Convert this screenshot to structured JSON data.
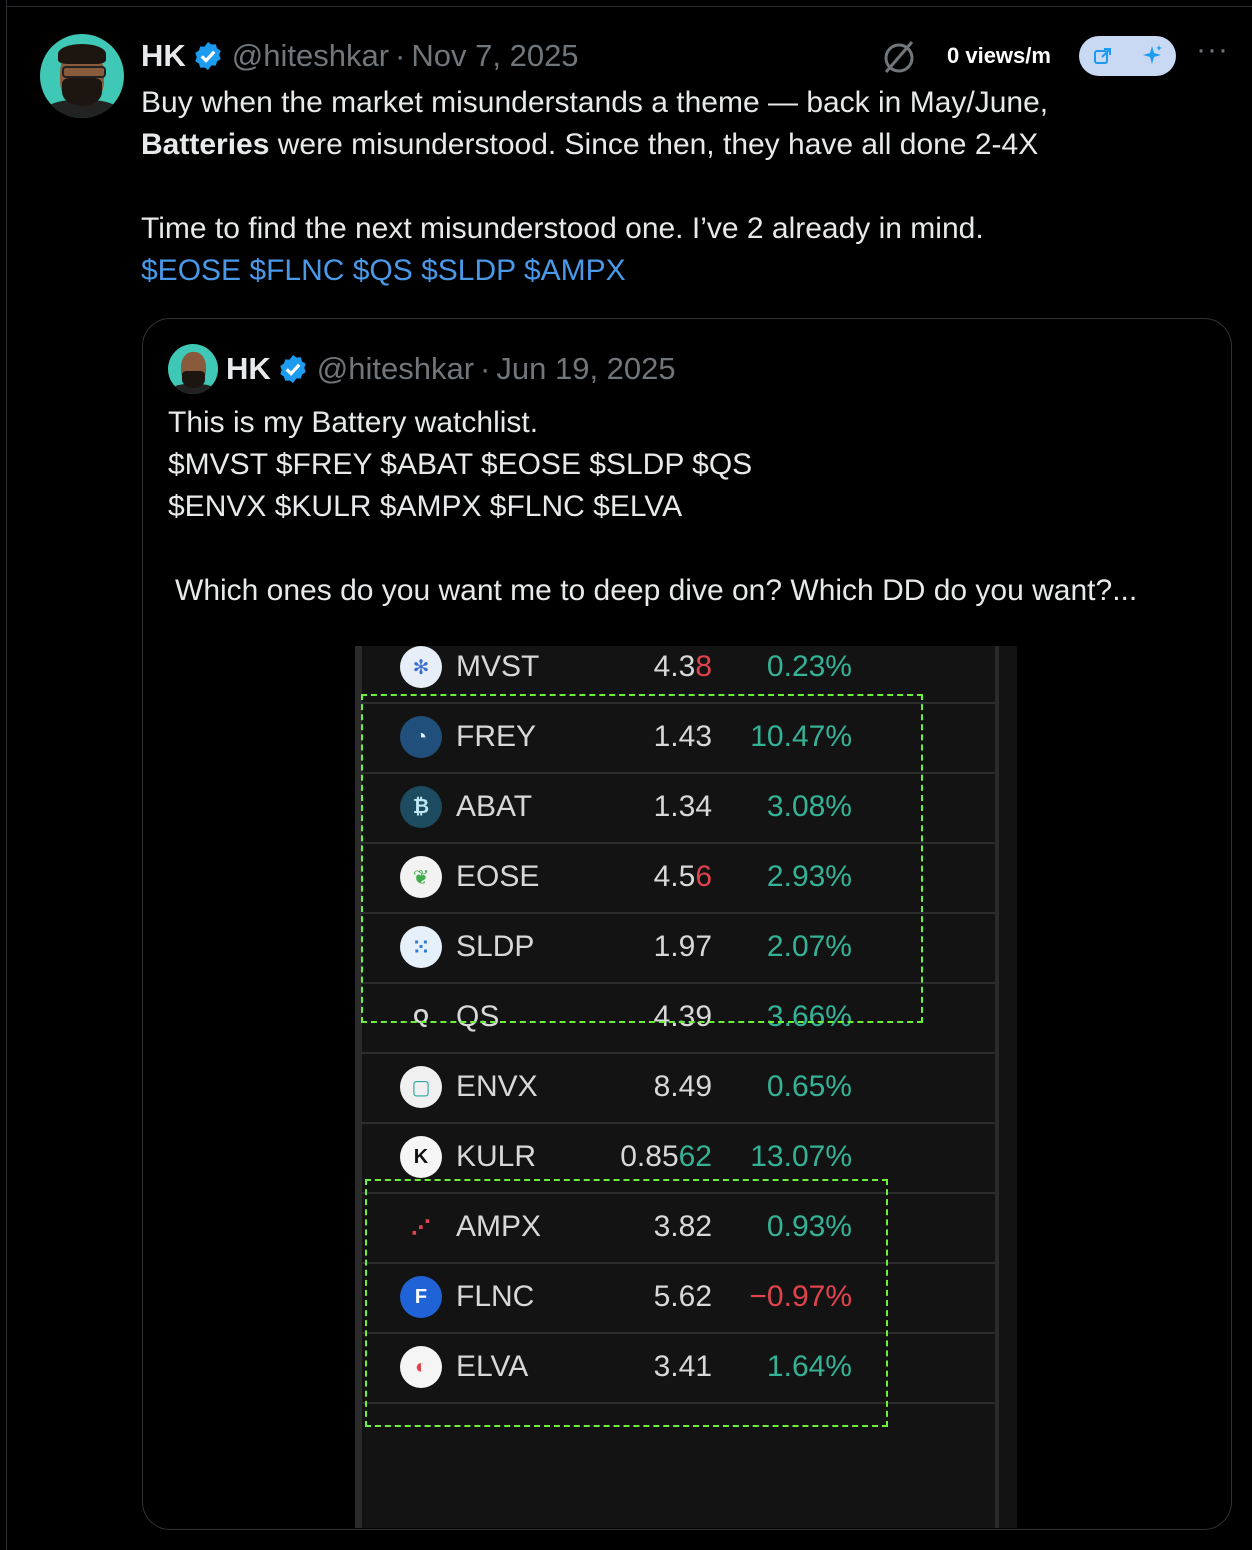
{
  "tweet": {
    "name": "HK",
    "handle": "@hiteshkar",
    "sep": "·",
    "date": "Nov 7, 2025",
    "views": "0 views/m",
    "line1": "Buy when the market misunderstands a theme — back in May/June,",
    "line2_bold": "Batteries",
    "line2_rest": " were misunderstood. Since then, they have all done 2-4X",
    "line3": "Time to find the next misunderstood one. I’ve 2 already in mind.",
    "tickers": "$EOSE $FLNC $QS $SLDP $AMPX"
  },
  "quote": {
    "name": "HK",
    "handle": "@hiteshkar",
    "sep": "·",
    "date": "Jun 19, 2025",
    "line1": "This is my Battery watchlist.",
    "line2": "$MVST $FREY $ABAT $EOSE $SLDP $QS",
    "line3": "$ENVX $KULR $AMPX $FLNC $ELVA",
    "line4": "Which ones do you want me to deep dive on? Which DD do you want?..."
  },
  "watchlist": [
    {
      "symbol": "MVST",
      "price_a": "4.3",
      "price_b": "8",
      "price_b_color": "red",
      "change": "0.23%",
      "dir": "pos",
      "icon": "snowflake-logo"
    },
    {
      "symbol": "FREY",
      "price_a": "1.43",
      "price_b": "",
      "price_b_color": "",
      "change": "10.47%",
      "dir": "pos",
      "icon": "freyr-logo"
    },
    {
      "symbol": "ABAT",
      "price_a": "1.34",
      "price_b": "",
      "price_b_color": "",
      "change": "3.08%",
      "dir": "pos",
      "icon": "abat-logo"
    },
    {
      "symbol": "EOSE",
      "price_a": "4.5",
      "price_b": "6",
      "price_b_color": "red",
      "change": "2.93%",
      "dir": "pos",
      "icon": "eose-leaf-logo"
    },
    {
      "symbol": "SLDP",
      "price_a": "1.97",
      "price_b": "",
      "price_b_color": "",
      "change": "2.07%",
      "dir": "pos",
      "icon": "sldp-logo"
    },
    {
      "symbol": "QS",
      "price_a": "4.39",
      "price_b": "",
      "price_b_color": "",
      "change": "3.66%",
      "dir": "pos",
      "icon": "qs-logo"
    },
    {
      "symbol": "ENVX",
      "price_a": "8.49",
      "price_b": "",
      "price_b_color": "",
      "change": "0.65%",
      "dir": "pos",
      "icon": "envx-logo"
    },
    {
      "symbol": "KULR",
      "price_a": "0.85",
      "price_b": "62",
      "price_b_color": "green",
      "change": "13.07%",
      "dir": "pos",
      "icon": "kulr-logo"
    },
    {
      "symbol": "AMPX",
      "price_a": "3.82",
      "price_b": "",
      "price_b_color": "",
      "change": "0.93%",
      "dir": "pos",
      "icon": "ampx-logo"
    },
    {
      "symbol": "FLNC",
      "price_a": "5.62",
      "price_b": "",
      "price_b_color": "",
      "change": "−0.97%",
      "dir": "neg",
      "icon": "flnc-logo"
    },
    {
      "symbol": "ELVA",
      "price_a": "3.41",
      "price_b": "",
      "price_b_color": "",
      "change": "1.64%",
      "dir": "pos",
      "icon": "elva-logo"
    }
  ],
  "colors": {
    "background": "#000000",
    "link": "#4a99e9",
    "muted": "#71767b",
    "positive": "#35b196",
    "negative": "#e0434d",
    "highlight_box": "#6cf03c",
    "verified": "#1d9bf0"
  }
}
